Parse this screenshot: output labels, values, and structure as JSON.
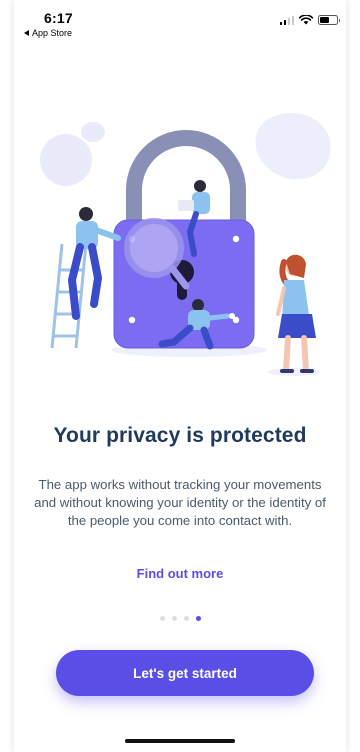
{
  "status_bar": {
    "time": "6:17",
    "back_label": "App Store"
  },
  "onboarding": {
    "title": "Your privacy is protected",
    "description": "The app works without tracking your movements and without knowing your identity or the identity of the people you come into contact with.",
    "link_label": "Find out more",
    "page_indicator": {
      "total": 4,
      "current": 4
    },
    "cta_label": "Let's get started"
  },
  "colors": {
    "accent": "#5b4ee6",
    "title": "#1f3a5c",
    "body_text": "#4a5a6c",
    "lock": "#7b6cf2",
    "shackle": "#8a8fb5",
    "blob": "#e9ebfa"
  },
  "icons": [
    "signal-icon",
    "wifi-icon",
    "battery-icon",
    "back-arrow-icon",
    "padlock-illustration"
  ]
}
